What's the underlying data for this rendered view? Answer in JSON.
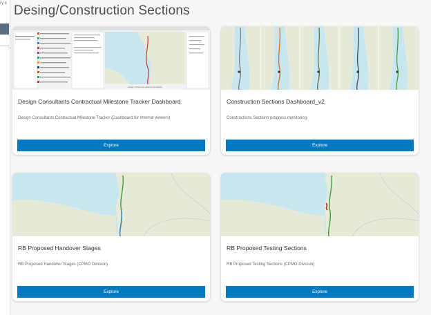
{
  "window_fragment": "ry e",
  "page_title": "Desing/Construction Sections",
  "cards": [
    {
      "title": "Design Consultants Contractual Milestone Tracker Dashboard",
      "description": "Design Consultants Contractual Milestone Tracker (Dashboard for internal viewers)",
      "button": "Explore",
      "thumbnail_caption": "Design / Priority Submittals by Consultants"
    },
    {
      "title": "Construction Sections Dashboard_v2",
      "description": "Constructions Sections progress monitoring",
      "button": "Explore"
    },
    {
      "title": "RB Proposed Handover Stages",
      "description": "RB Proposed Handover Stages (CPMO Division)",
      "button": "Explore"
    },
    {
      "title": "RB Proposed Testing Sections",
      "description": "RB Proposed Testing Sections (CPMO Division)",
      "button": "Explore"
    }
  ],
  "colors": {
    "accent": "#0079c1",
    "sea": "#c8e6ef",
    "land": "#e6ead9",
    "route_green": "#3f9b3a",
    "route_orange": "#d2702a",
    "route_red": "#c0392b"
  }
}
